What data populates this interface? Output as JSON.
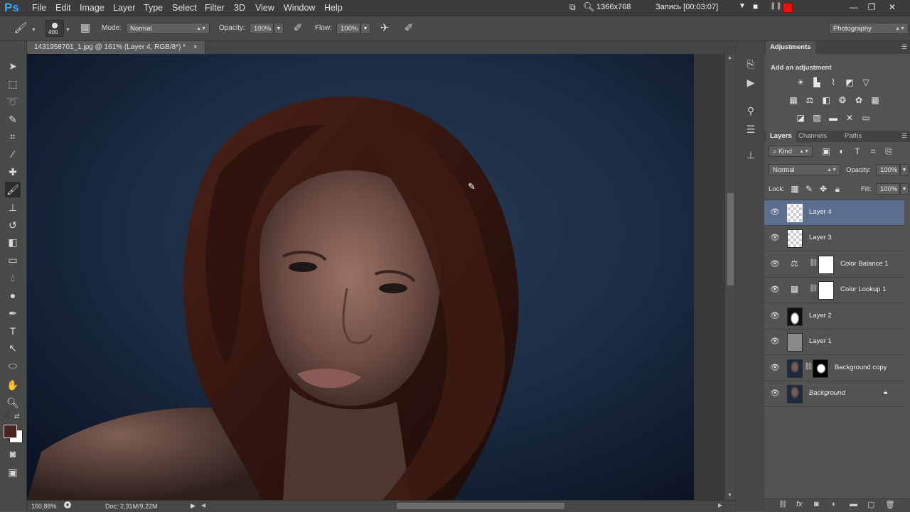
{
  "app": {
    "logo": "Ps"
  },
  "menu": [
    "File",
    "Edit",
    "Image",
    "Layer",
    "Type",
    "Select",
    "Filter",
    "3D",
    "View",
    "Window",
    "Help"
  ],
  "recorder": {
    "resolution": "1366x768",
    "status": "Запись [00:03:07]"
  },
  "options_bar": {
    "brush_size": "400",
    "mode_label": "Mode:",
    "mode_value": "Normal",
    "opacity_label": "Opacity:",
    "opacity_value": "100%",
    "flow_label": "Flow:",
    "flow_value": "100%",
    "workspace": "Photography"
  },
  "document": {
    "tab_title": "1431958701_1.jpg @ 161% (Layer 4, RGB/8*) *",
    "close_glyph": "×"
  },
  "status": {
    "zoom": "160,88%",
    "doc_size": "Doc: 2,31M/9,22M"
  },
  "adjustments": {
    "title": "Adjustments",
    "subtitle": "Add an adjustment"
  },
  "layers_panel": {
    "tabs": [
      "Layers",
      "Channels",
      "Paths"
    ],
    "filter_kind": "Kind",
    "blend_mode": "Normal",
    "opacity_label": "Opacity:",
    "opacity_value": "100%",
    "lock_label": "Lock:",
    "fill_label": "Fill:",
    "fill_value": "100%",
    "layers": [
      {
        "name": "Layer 4",
        "selected": true
      },
      {
        "name": "Layer 3"
      },
      {
        "name": "Color Balance 1"
      },
      {
        "name": "Color Lookup 1"
      },
      {
        "name": "Layer 2"
      },
      {
        "name": "Layer 1"
      },
      {
        "name": "Background copy"
      },
      {
        "name": "Background",
        "locked": true
      }
    ]
  }
}
